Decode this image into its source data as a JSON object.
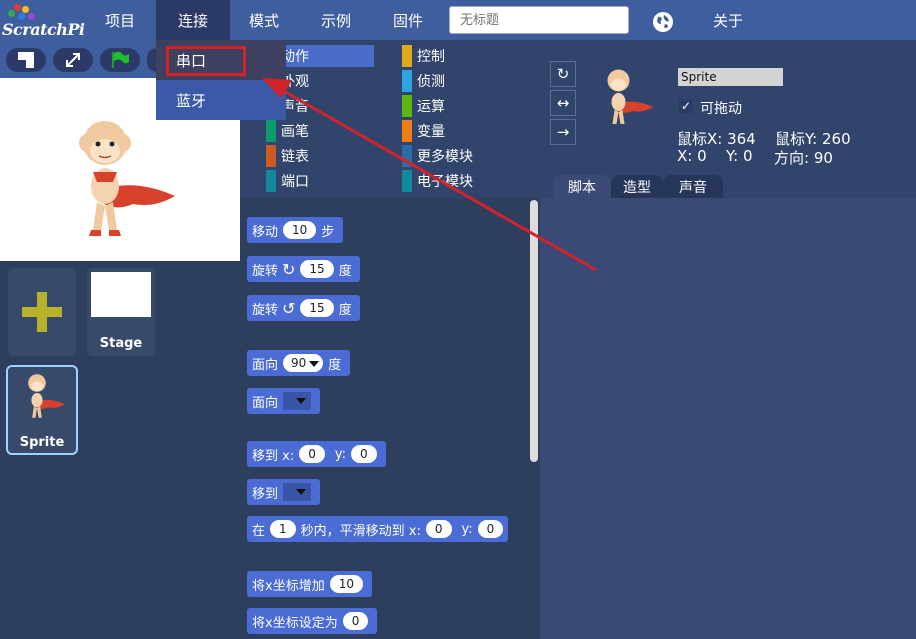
{
  "app": {
    "logo": "ScratchPi"
  },
  "top_menu": {
    "items": [
      "项目",
      "连接",
      "模式",
      "示例",
      "固件"
    ],
    "title_placeholder": "无标题",
    "about": "关于"
  },
  "connect_menu": {
    "items": [
      "串口",
      "蓝牙"
    ]
  },
  "stage_toolbar": {
    "icons": [
      "shrink-stage-icon",
      "fullscreen-icon",
      "green-flag-icon"
    ]
  },
  "sprite_list": {
    "stage_label": "Stage",
    "sprite_label": "Sprite"
  },
  "categories": {
    "left": [
      "动作",
      "外观",
      "声音",
      "画笔",
      "链表",
      "端口"
    ],
    "right": [
      "控制",
      "侦测",
      "运算",
      "变量",
      "更多模块",
      "电子模块"
    ],
    "colors_left": [
      "#4a6cd4",
      "#8a55d7",
      "#bb42c3",
      "#0e9a6c",
      "#cc5b22",
      "#0e8a9a"
    ],
    "colors_right": [
      "#e1a91a",
      "#2ca5e2",
      "#5cb712",
      "#ee7d16",
      "#2c6da8",
      "#0e8a9a"
    ],
    "selected": "动作"
  },
  "blocks": {
    "move": {
      "label": "移动",
      "value": "10",
      "unit": "步"
    },
    "turn_right": {
      "label": "旋转",
      "value": "15",
      "unit": "度"
    },
    "turn_left": {
      "label": "旋转",
      "value": "15",
      "unit": "度"
    },
    "point_dir": {
      "label": "面向",
      "value": "90",
      "unit": "度"
    },
    "point_towards": {
      "label": "面向"
    },
    "goto_xy": {
      "label": "移到 x:",
      "x": "0",
      "y_label": "y:",
      "y": "0"
    },
    "goto": {
      "label": "移到"
    },
    "glide": {
      "label_a": "在",
      "secs": "1",
      "label_b": "秒内，平滑移动到 x:",
      "x": "0",
      "y_label": "y:",
      "y": "0"
    },
    "change_x": {
      "label": "将x坐标增加",
      "value": "10"
    },
    "set_x": {
      "label": "将x坐标设定为",
      "value": "0"
    }
  },
  "sprite_info": {
    "name": "Sprite",
    "draggable_label": "可拖动",
    "mouse_x": "鼠标X: 364",
    "mouse_y": "鼠标Y: 260",
    "x": "X: 0",
    "y": "Y: 0",
    "direction": "方向: 90",
    "rotation_icons": [
      "↻",
      "↔",
      "→"
    ]
  },
  "editor_tabs": [
    "脚本",
    "造型",
    "声音"
  ],
  "annotation": {
    "color": "#d2232a"
  }
}
